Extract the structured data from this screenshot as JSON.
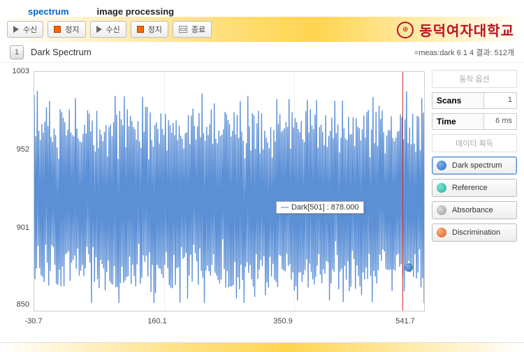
{
  "tabs": {
    "spectrum": "spectrum",
    "imageprocessing": "image processing"
  },
  "toolbar": {
    "recv": "수신",
    "stop": "정지",
    "end": "종료"
  },
  "brand": {
    "name": "동덕여자대학교"
  },
  "title": {
    "num": "1",
    "text": "Dark Spectrum",
    "status": "=meas:dark 6 1 4 결과: 512개"
  },
  "sidebar": {
    "head_action": "동작 옵션",
    "scans": {
      "label": "Scans",
      "value": "1"
    },
    "time": {
      "label": "Time",
      "value": "6 ms"
    },
    "head_acq": "데이터 획득",
    "buttons": {
      "dark": "Dark spectrum",
      "reference": "Reference",
      "absorbance": "Absorbance",
      "discrimination": "Discrimination"
    }
  },
  "tooltip": {
    "label": "Dark[501] : 878.000"
  },
  "chart_data": {
    "type": "line",
    "title": "",
    "xlabel": "",
    "ylabel": "",
    "xlim": [
      -30.7,
      541.7
    ],
    "ylim": [
      850,
      1003
    ],
    "xticks": [
      -30.7,
      160.1,
      350.9,
      541.7
    ],
    "yticks": [
      850,
      901,
      952,
      1003
    ],
    "cursor_x": 510,
    "marker": {
      "x": 520,
      "y": 878
    },
    "series": [
      {
        "name": "Dark",
        "values_summary": "512-point noise signal oscillating roughly between 870 and 985, mean≈920; dense vertical spikes across full x-range; value at index 501 is 878.000",
        "sample_y": [
          940,
          880,
          975,
          890,
          960,
          905,
          980,
          875,
          955,
          900,
          970,
          885,
          960,
          910,
          985,
          878,
          945,
          895,
          970,
          880,
          955,
          905,
          978,
          890,
          950,
          900,
          965,
          885,
          958,
          897,
          972,
          880
        ]
      }
    ]
  }
}
